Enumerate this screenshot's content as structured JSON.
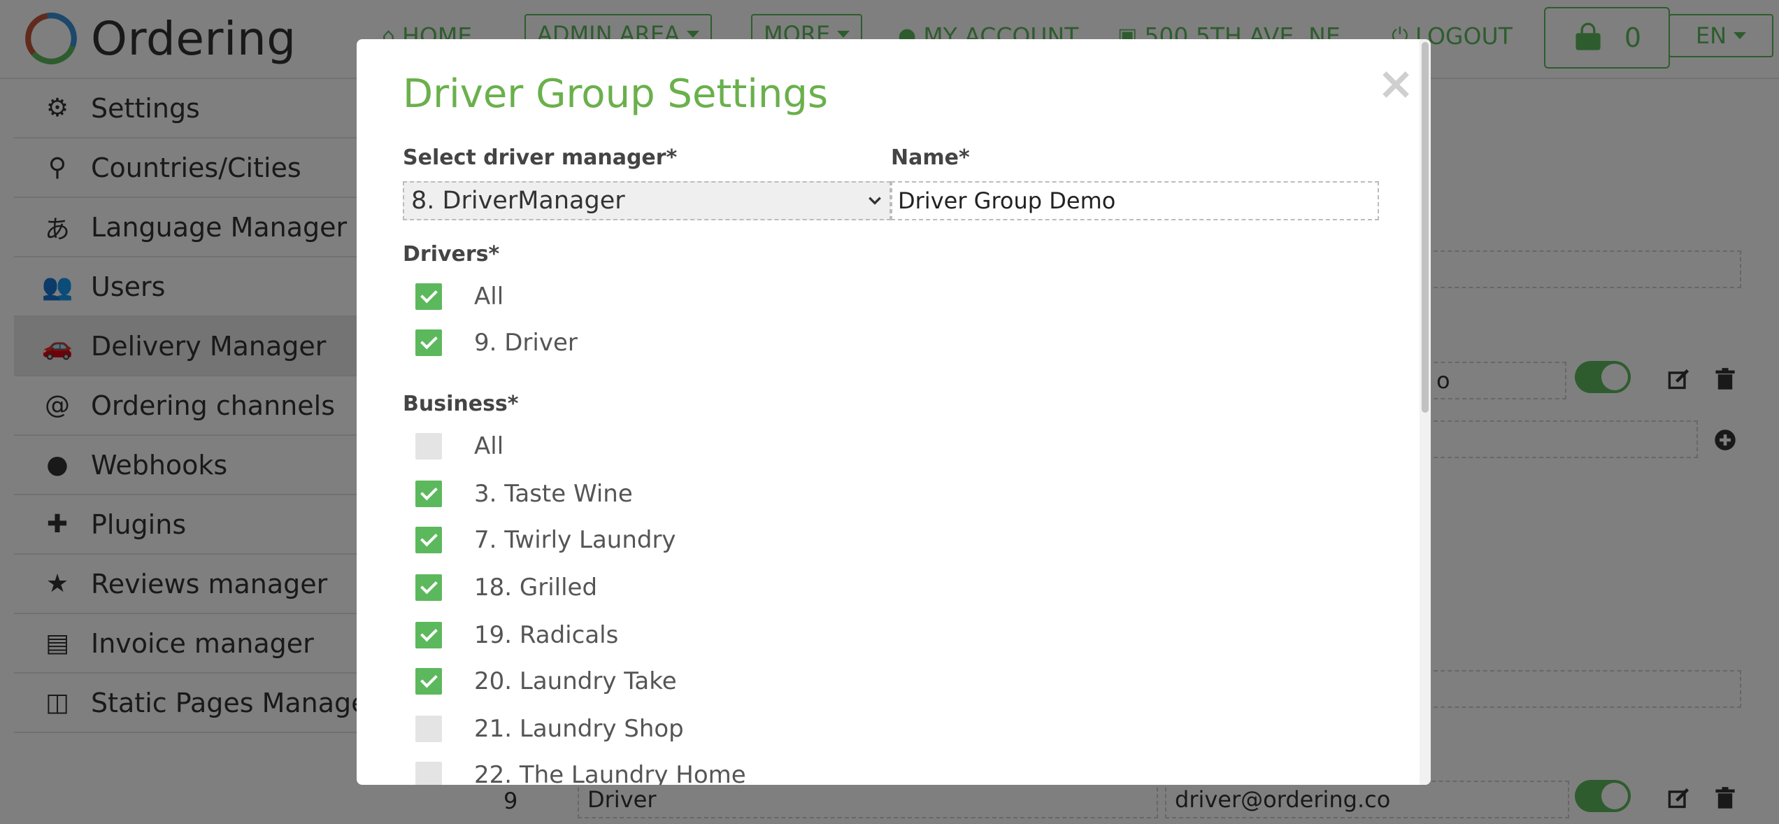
{
  "navbar": {
    "brand": "Ordering",
    "home": "HOME",
    "admin_area": "ADMIN AREA",
    "more": "MORE",
    "my_account": "MY ACCOUNT",
    "address": "500 5TH AVE. NE",
    "logout": "LOGOUT",
    "cart_count": "0",
    "language": "EN"
  },
  "sidebar": {
    "items": [
      {
        "label": "Settings",
        "icon": "gear-icon"
      },
      {
        "label": "Countries/Cities",
        "icon": "map-marker-icon"
      },
      {
        "label": "Language Manager",
        "icon": "translate-icon"
      },
      {
        "label": "Users",
        "icon": "users-icon"
      },
      {
        "label": "Delivery Manager",
        "icon": "car-icon"
      },
      {
        "label": "Ordering channels",
        "icon": "at-icon"
      },
      {
        "label": "Webhooks",
        "icon": "globe-icon"
      },
      {
        "label": "Plugins",
        "icon": "puzzle-icon"
      },
      {
        "label": "Reviews manager",
        "icon": "star-icon"
      },
      {
        "label": "Invoice manager",
        "icon": "file-icon"
      },
      {
        "label": "Static Pages Manager",
        "icon": "columns-icon"
      }
    ],
    "active_index": 4
  },
  "background": {
    "row1_name_tail": "o",
    "row2_id": "9",
    "row2_name": "Driver",
    "row2_email": "driver@ordering.co"
  },
  "modal": {
    "title": "Driver Group Settings",
    "close": "×",
    "manager_label": "Select driver manager*",
    "manager_value": "8. DriverManager",
    "name_label": "Name*",
    "name_value": "Driver Group Demo",
    "drivers_label": "Drivers*",
    "drivers": [
      {
        "label": "All",
        "checked": true
      },
      {
        "label": "9. Driver",
        "checked": true
      }
    ],
    "business_label": "Business*",
    "businesses": [
      {
        "label": "All",
        "checked": false
      },
      {
        "label": "3. Taste Wine",
        "checked": true
      },
      {
        "label": "7. Twirly Laundry",
        "checked": true
      },
      {
        "label": "18. Grilled",
        "checked": true
      },
      {
        "label": "19. Radicals",
        "checked": true
      },
      {
        "label": "20. Laundry Take",
        "checked": true
      },
      {
        "label": "21. Laundry Shop",
        "checked": false
      },
      {
        "label": "22. The Laundry Home",
        "checked": false
      }
    ]
  },
  "colors": {
    "accent": "#5cb85c",
    "title": "#6ab04c"
  }
}
